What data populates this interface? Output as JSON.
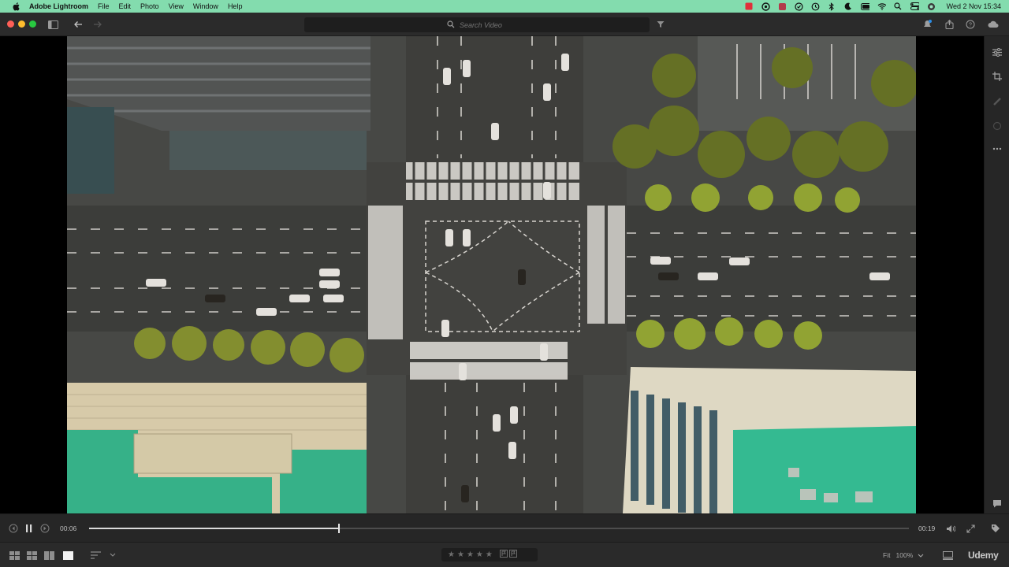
{
  "menubar": {
    "app_name": "Adobe Lightroom",
    "menus": [
      "File",
      "Edit",
      "Photo",
      "View",
      "Window",
      "Help"
    ],
    "clock": "Wed 2 Nov  15:34"
  },
  "toolbar": {
    "search_placeholder": "Search Video"
  },
  "playback": {
    "current_time": "00:06",
    "duration": "00:19",
    "progress_fraction": 0.305
  },
  "bottom": {
    "stars": [
      "★",
      "★",
      "★",
      "★",
      "★"
    ],
    "zoom_mode": "Fit",
    "zoom_level": "100%",
    "watermark": "Udemy"
  },
  "colors": {
    "menubar_bg": "#83dcae",
    "toolbar_bg": "#2b2b2b",
    "panel_bg": "#262626"
  }
}
